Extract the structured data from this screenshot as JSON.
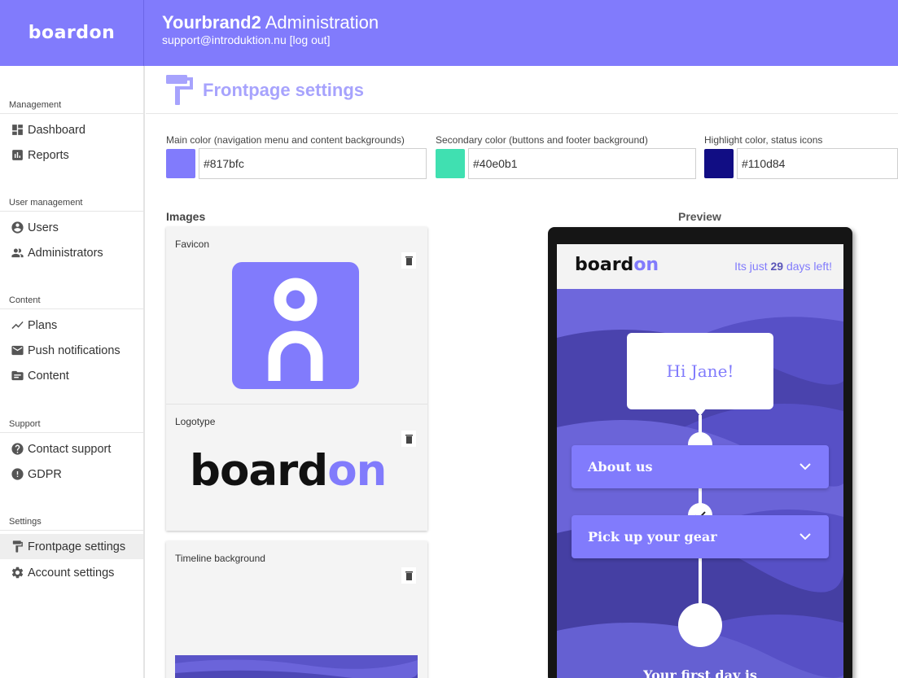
{
  "header": {
    "brand_logo_text": "boardon",
    "title_bold": "Yourbrand2",
    "title_rest": " Administration",
    "email": "support@introduktion.nu",
    "logout": "[log out]"
  },
  "sidebar": {
    "sections": [
      {
        "heading": "Management",
        "items": [
          {
            "label": "Dashboard",
            "icon": "dashboard-icon"
          },
          {
            "label": "Reports",
            "icon": "bar-chart-icon"
          }
        ]
      },
      {
        "heading": "User management",
        "items": [
          {
            "label": "Users",
            "icon": "user-circle-icon"
          },
          {
            "label": "Administrators",
            "icon": "people-icon"
          }
        ]
      },
      {
        "heading": "Content",
        "items": [
          {
            "label": "Plans",
            "icon": "trend-line-icon"
          },
          {
            "label": "Push notifications",
            "icon": "mail-icon"
          },
          {
            "label": "Content",
            "icon": "folder-icon"
          }
        ]
      },
      {
        "heading": "Support",
        "items": [
          {
            "label": "Contact support",
            "icon": "help-circle-icon"
          },
          {
            "label": "GDPR",
            "icon": "alert-circle-icon"
          }
        ]
      },
      {
        "heading": "Settings",
        "items": [
          {
            "label": "Frontpage settings",
            "icon": "paint-roller-icon",
            "active": true
          },
          {
            "label": "Account settings",
            "icon": "gear-icon"
          }
        ]
      }
    ]
  },
  "page": {
    "title": "Frontpage settings",
    "title_icon": "paint-roller-icon"
  },
  "colors": {
    "main": {
      "label": "Main color (navigation menu and content backgrounds)",
      "value": "#817bfc"
    },
    "secondary": {
      "label": "Secondary color (buttons and footer background)",
      "value": "#40e0b1"
    },
    "highlight": {
      "label": "Highlight color, status icons",
      "value": "#110d84"
    }
  },
  "images": {
    "heading": "Images",
    "favicon_label": "Favicon",
    "logotype_label": "Logotype",
    "logotype_text_a": "board",
    "logotype_text_b": "on",
    "timeline_label": "Timeline background"
  },
  "preview": {
    "heading": "Preview",
    "logo_a": "board",
    "logo_b": "on",
    "days_prefix": "Its just ",
    "days_count": "29",
    "days_suffix": " days left!",
    "greeting": "Hi Jane!",
    "accordion_1": "About us",
    "accordion_2": "Pick up your gear",
    "first_day": "Your first day is"
  }
}
